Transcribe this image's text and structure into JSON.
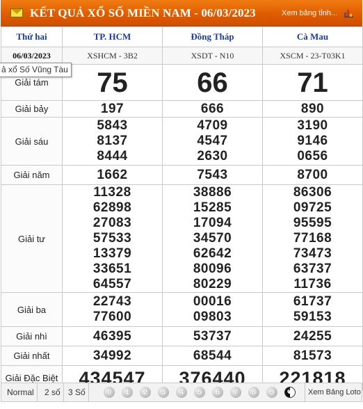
{
  "header": {
    "title": "KẾT QUẢ XỔ SỐ MIỀN NAM - 06/03/2023",
    "print_link": "Xem bảng tỉnh...",
    "accent_color": "#e8620a"
  },
  "table": {
    "day": "Thứ hai",
    "date": "06/03/2023",
    "provinces": [
      "TP. HCM",
      "Đồng Tháp",
      "Cà Mau"
    ],
    "codes": [
      "XSHCM - 3B2",
      "XSDT - N10",
      "XSCM - 23-T03K1"
    ],
    "rows": [
      {
        "label": "Giải tám",
        "values": [
          [
            "75"
          ],
          [
            "66"
          ],
          [
            "71"
          ]
        ]
      },
      {
        "label": "Giải bảy",
        "values": [
          [
            "197"
          ],
          [
            "666"
          ],
          [
            "890"
          ]
        ]
      },
      {
        "label": "Giải sáu",
        "values": [
          [
            "5843",
            "8137",
            "8444"
          ],
          [
            "4709",
            "4547",
            "2630"
          ],
          [
            "3190",
            "9146",
            "0656"
          ]
        ]
      },
      {
        "label": "Giải năm",
        "values": [
          [
            "1662"
          ],
          [
            "7543"
          ],
          [
            "8700"
          ]
        ]
      },
      {
        "label": "Giải tư",
        "values": [
          [
            "11328",
            "62898",
            "27083",
            "57533",
            "13379",
            "33651",
            "64557"
          ],
          [
            "38886",
            "15285",
            "17094",
            "34570",
            "62642",
            "80096",
            "80229"
          ],
          [
            "86306",
            "09725",
            "95595",
            "77168",
            "73473",
            "63737",
            "11736"
          ]
        ]
      },
      {
        "label": "Giải ba",
        "values": [
          [
            "22743",
            "77600"
          ],
          [
            "00016",
            "09803"
          ],
          [
            "61737",
            "59153"
          ]
        ]
      },
      {
        "label": "Giải nhì",
        "values": [
          [
            "46395"
          ],
          [
            "53737"
          ],
          [
            "24255"
          ]
        ]
      },
      {
        "label": "Giải nhất",
        "values": [
          [
            "34992"
          ],
          [
            "68544"
          ],
          [
            "81573"
          ]
        ]
      },
      {
        "label": "Giải Đặc Biệt",
        "values": [
          [
            "434547"
          ],
          [
            "376440"
          ],
          [
            "221818"
          ]
        ]
      }
    ]
  },
  "tooltip": "ả xổ Số Vũng Tàu",
  "bottom_bar": {
    "modes": [
      "Normal",
      "2 số",
      "3 Số"
    ],
    "digits": [
      "0",
      "1",
      "2",
      "3",
      "4",
      "5",
      "6",
      "7",
      "8",
      "9"
    ],
    "yinyang_icon": "yin-yang-icon",
    "loto_link": "Xem Bảng Loto"
  }
}
